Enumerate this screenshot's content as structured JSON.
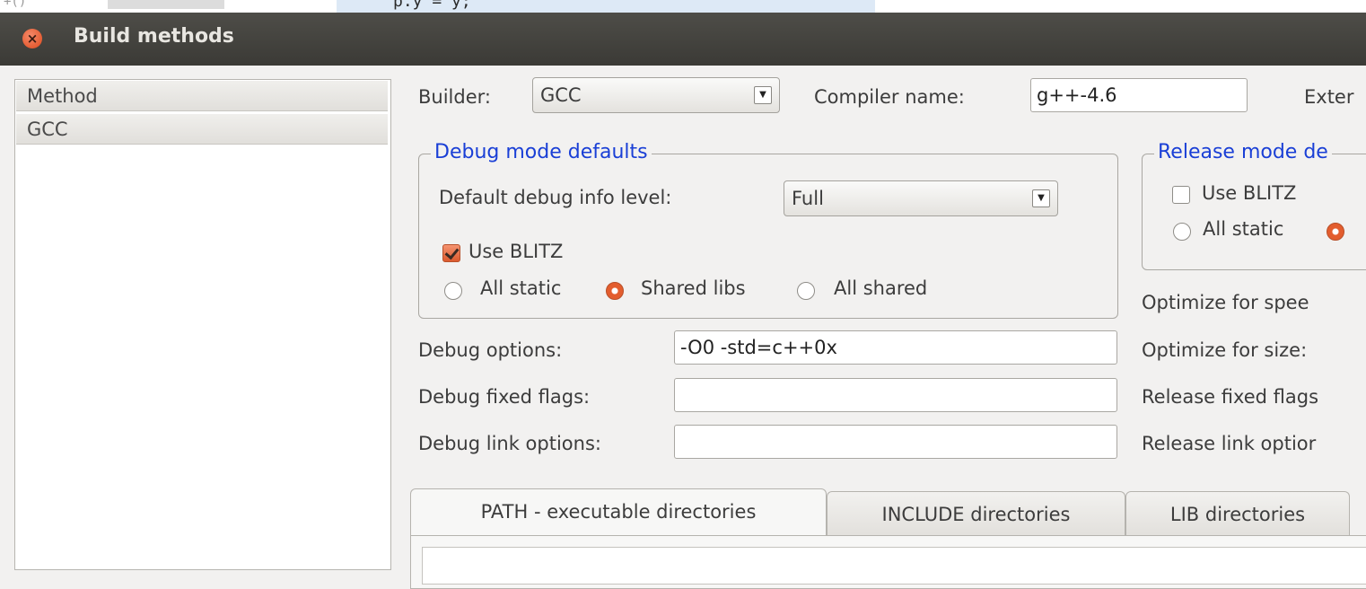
{
  "background": {
    "line_number": "+()",
    "code": "p.y = y;"
  },
  "window": {
    "title": "Build methods"
  },
  "methods": {
    "header": "Method",
    "items": [
      "GCC"
    ]
  },
  "builder": {
    "label": "Builder:",
    "value": "GCC",
    "compiler_label": "Compiler name:",
    "compiler_value": "g++-4.6",
    "extra_label": "Exter"
  },
  "debug": {
    "group_title": "Debug mode defaults",
    "info_level_label": "Default debug info level:",
    "info_level_value": "Full",
    "use_blitz": "Use BLITZ",
    "use_blitz_checked": true,
    "link_modes": [
      "All static",
      "Shared libs",
      "All shared"
    ],
    "selected_link_mode": "Shared libs",
    "options_label": "Debug options:",
    "options_value": "-O0 -std=c++0x",
    "fixed_flags_label": "Debug fixed flags:",
    "fixed_flags_value": "",
    "link_options_label": "Debug link options:",
    "link_options_value": ""
  },
  "release": {
    "group_title": "Release mode de",
    "use_blitz": "Use BLITZ",
    "use_blitz_checked": false,
    "all_static": "All static",
    "opt_speed_label": "Optimize for spee",
    "opt_size_label": "Optimize for size:",
    "fixed_flags_label": "Release fixed flags",
    "link_options_label": "Release link optior"
  },
  "tabs": [
    "PATH - executable directories",
    "INCLUDE directories",
    "LIB directories"
  ],
  "active_tab": "PATH - executable directories",
  "colors": {
    "accent": "#e35d2e",
    "group_title": "#1a3fd6",
    "titlebar": "#3b3a36"
  }
}
